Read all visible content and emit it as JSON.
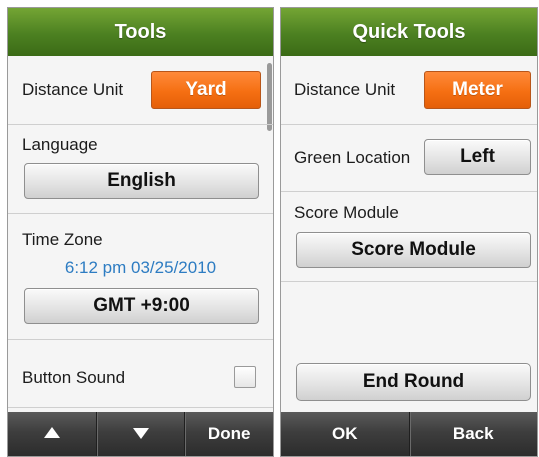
{
  "left_screen": {
    "title": "Tools",
    "distance_unit": {
      "label": "Distance Unit",
      "value": "Yard"
    },
    "language": {
      "label": "Language",
      "value": "English"
    },
    "time_zone": {
      "label": "Time Zone",
      "current_time": "6:12 pm 03/25/2010",
      "value": "GMT +9:00"
    },
    "button_sound": {
      "label": "Button Sound",
      "checked": false
    },
    "bottom_bar": {
      "up_icon": "up-arrow-icon",
      "down_icon": "down-arrow-icon",
      "done_label": "Done"
    }
  },
  "right_screen": {
    "title": "Quick Tools",
    "distance_unit": {
      "label": "Distance Unit",
      "value": "Meter"
    },
    "green_location": {
      "label": "Green Location",
      "value": "Left"
    },
    "score_module": {
      "label": "Score Module",
      "button_label": "Score Module"
    },
    "end_round_label": "End Round",
    "bottom_bar": {
      "ok_label": "OK",
      "back_label": "Back"
    }
  },
  "colors": {
    "title_green": "#4c8021",
    "accent_orange": "#f56f12",
    "time_blue": "#2d7cc2",
    "bottom_bar": "#3e3e3e"
  }
}
